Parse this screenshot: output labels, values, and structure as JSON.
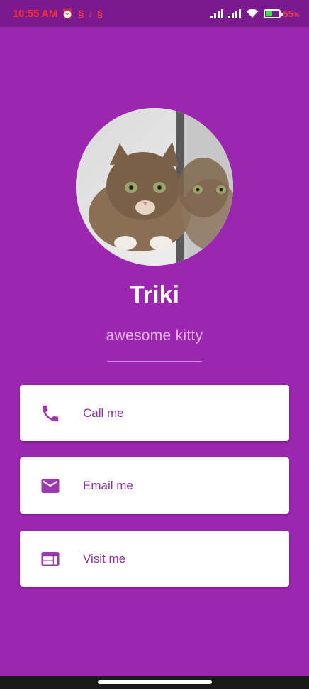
{
  "status_bar": {
    "time": "10:55 AM",
    "battery_percent": "55",
    "battery_suffix": "%",
    "battery_level": 0.55,
    "left_icons": [
      "alarm-icon",
      "notification-icon",
      "tiktok-icon",
      "notification-icon"
    ],
    "right_icons": [
      "signal-icon",
      "signal-icon",
      "wifi-icon",
      "battery-charging-icon"
    ]
  },
  "profile": {
    "name": "Triki",
    "subtitle": "awesome kitty",
    "avatar_icon": "kitten-photo"
  },
  "actions": [
    {
      "label": "Call me",
      "icon": "phone-icon"
    },
    {
      "label": "Email me",
      "icon": "email-icon"
    },
    {
      "label": "Visit me",
      "icon": "web-icon"
    }
  ],
  "colors": {
    "background": "#9b27b0",
    "status_bar": "#7b1a8e",
    "card": "#ffffff",
    "accent": "#8f2fa3",
    "subtitle": "#e2b3ea",
    "status_text": "#ff2d2d"
  }
}
